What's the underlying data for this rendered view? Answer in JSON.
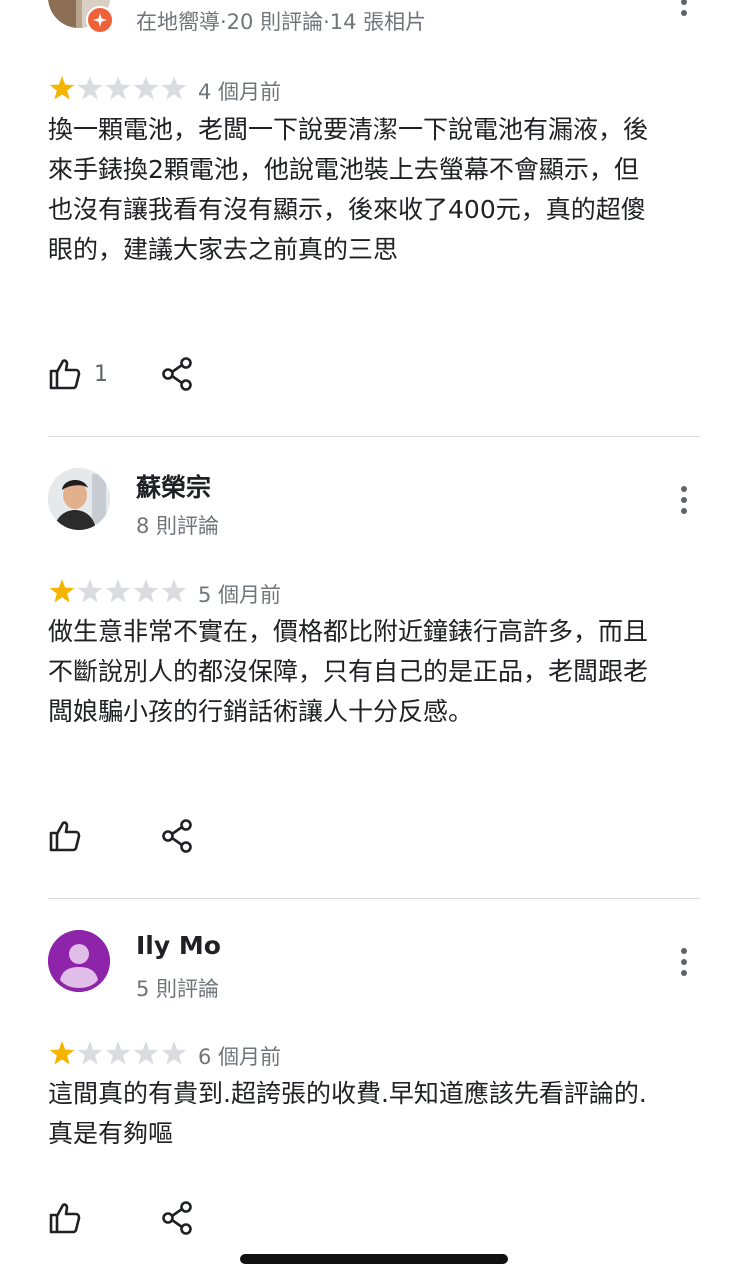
{
  "reviews": [
    {
      "author": "",
      "meta": "在地嚮導·20 則評論·14 張相片",
      "rating": 1,
      "time": "4 個月前",
      "text": "換一顆電池，老闆一下說要清潔一下說電池有漏液，後來手錶換2顆電池，他說電池裝上去螢幕不會顯示，但也沒有讓我看有沒有顯示，後來收了400元，真的超傻眼的，建議大家去之前真的三思",
      "likes": "1",
      "avatar": "photo",
      "badge": "local-guide-icon"
    },
    {
      "author": "蘇榮宗",
      "meta": "8 則評論",
      "rating": 1,
      "time": "5 個月前",
      "text": "做生意非常不實在，價格都比附近鐘錶行高許多，而且不斷說別人的都沒保障，只有自己的是正品，老闆跟老闆娘騙小孩的行銷話術讓人十分反感。",
      "likes": "",
      "avatar": "photo"
    },
    {
      "author": "Ily Mo",
      "meta": "5 則評論",
      "rating": 1,
      "time": "6 個月前",
      "text": "這間真的有貴到.超誇張的收費.早知道應該先看評論的.真是有夠嘔",
      "likes": "",
      "avatar": "default-person-icon"
    }
  ],
  "colors": {
    "star_filled": "#f4b400",
    "star_empty": "#dadce0",
    "text_primary": "#202124",
    "text_secondary": "#70757a",
    "icon": "#202124",
    "avatar_default": "#8e24aa",
    "badge": "#f0613a"
  }
}
